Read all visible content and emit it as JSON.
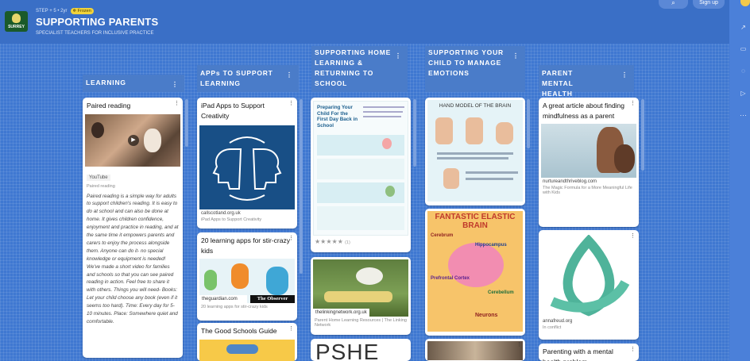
{
  "header": {
    "breadcrumb": "STEP + 5 • 2yr",
    "frozen": "Frozen",
    "title": "SUPPORTING PARENTS",
    "subtitle": "SPECIALIST TEACHERS FOR INCLUSIVE PRACTICE",
    "logo_text": "SURREY",
    "signup": "Sign up"
  },
  "rail": {
    "icons": [
      "bell-icon",
      "share-icon",
      "slideshow-icon",
      "search-icon",
      "play-icon",
      "more-icon"
    ]
  },
  "columns": [
    {
      "title": "LEARNING"
    },
    {
      "title": "APPs TO SUPPORT LEARNING"
    },
    {
      "title": "SUPPORTING HOME LEARNING & RETURNING TO SCHOOL"
    },
    {
      "title": "SUPPORTING YOUR CHILD TO MANAGE EMOTIONS"
    },
    {
      "title": "PARENT MENTAL HEALTH"
    }
  ],
  "cards": {
    "paired": {
      "title": "Paired reading",
      "source": "YouTube",
      "caption": "Paired reading",
      "body": "Paired reading is a simple way for adults to support children's reading. It is easy to do at school and can also be done at home. It gives children confidence, enjoyment and practice in reading, and at the same time it empowers parents and carers to enjoy the process alongside them. Anyone can do it- no special knowledge or equipment is needed! We've made a short video for families and schools so that you can see paired reading in action. Feel free to share it with others. Things you will need- Books: Let your child choose any book (even if it seems too hard). Time: Every day for 5-10 minutes. Place: Somewhere quiet and comfortable."
    },
    "ipad": {
      "title": "iPad Apps to Support Creativity",
      "source": "callscotland.org.uk",
      "caption": "iPad Apps to Support Creativity"
    },
    "stircrazy": {
      "title": "20 learning apps for stir-crazy kids",
      "source": "theguardian.com",
      "badge": "The Observer",
      "caption": "20 learning apps for stir-crazy kids"
    },
    "goodschools": {
      "title": "The Good Schools Guide"
    },
    "preparing": {
      "doc_title": "Preparing Your Child For the First Day Back in School",
      "rating": "★★★★★",
      "rating_count": "(1)"
    },
    "linking": {
      "source": "thelinkingnetwork.org.uk",
      "caption": "Parent Home Learning Resources | The Linking Network"
    },
    "pshe": {
      "text": "PSHE"
    },
    "handmodel": {
      "heading": "HAND MODEL OF THE BRAIN"
    },
    "elasticbrain": {
      "heading": "FANTASTIC ELASTIC BRAIN",
      "labels": [
        "Cerebrum",
        "Hippocampus",
        "Prefrontal Cortex",
        "Cerebellum",
        "Neurons"
      ]
    },
    "mindfulness": {
      "title": "A great article about finding mindfulness as a parent",
      "source": "nurtureandthriveblog.com",
      "caption": "The Magic Formula for a More Meaningful Life with Kids"
    },
    "annafreud": {
      "source": "annafreud.org",
      "caption": "In conflict"
    },
    "mentalhealth": {
      "title": "Parenting with a mental health problem"
    }
  },
  "colors": {
    "background": "#3f78d1",
    "column_header": "#4a7cc9",
    "frozen_badge": "#f1d33b"
  }
}
